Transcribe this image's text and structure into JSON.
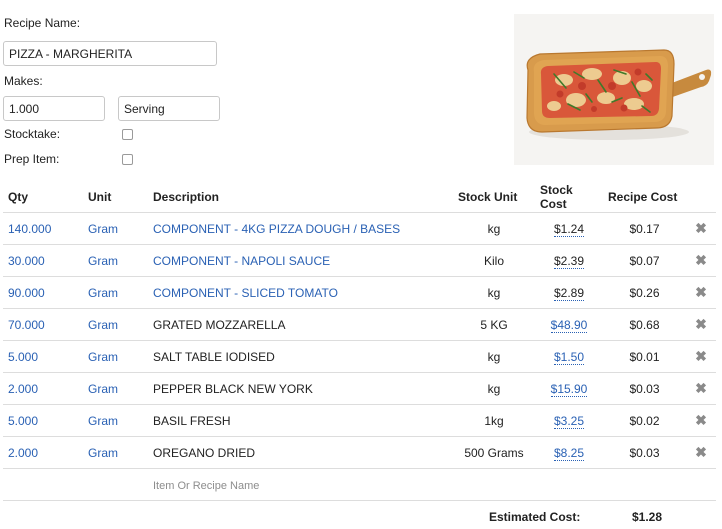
{
  "form": {
    "recipe_name_label": "Recipe Name:",
    "recipe_name_value": "PIZZA - MARGHERITA",
    "makes_label": "Makes:",
    "makes_qty": "1.000",
    "makes_unit": "Serving",
    "stocktake_label": "Stocktake:",
    "stocktake_checked": false,
    "prep_item_label": "Prep Item:",
    "prep_item_checked": false
  },
  "table": {
    "headers": [
      "Qty",
      "Unit",
      "Description",
      "Stock Unit",
      "Stock Cost",
      "Recipe Cost"
    ],
    "rows": [
      {
        "qty": "140.000",
        "unit": "Gram",
        "description": "COMPONENT - 4KG PIZZA DOUGH / BASES",
        "desc_link": true,
        "stock_unit": "kg",
        "stock_cost": "$1.24",
        "cost_link": false,
        "recipe_cost": "$0.17"
      },
      {
        "qty": "30.000",
        "unit": "Gram",
        "description": "COMPONENT - NAPOLI SAUCE",
        "desc_link": true,
        "stock_unit": "Kilo",
        "stock_cost": "$2.39",
        "cost_link": false,
        "recipe_cost": "$0.07"
      },
      {
        "qty": "90.000",
        "unit": "Gram",
        "description": "COMPONENT - SLICED TOMATO",
        "desc_link": true,
        "stock_unit": "kg",
        "stock_cost": "$2.89",
        "cost_link": false,
        "recipe_cost": "$0.26"
      },
      {
        "qty": "70.000",
        "unit": "Gram",
        "description": "GRATED MOZZARELLA",
        "desc_link": false,
        "stock_unit": "5 KG",
        "stock_cost": "$48.90",
        "cost_link": true,
        "recipe_cost": "$0.68"
      },
      {
        "qty": "5.000",
        "unit": "Gram",
        "description": "SALT TABLE IODISED",
        "desc_link": false,
        "stock_unit": "kg",
        "stock_cost": "$1.50",
        "cost_link": true,
        "recipe_cost": "$0.01"
      },
      {
        "qty": "2.000",
        "unit": "Gram",
        "description": "PEPPER BLACK NEW YORK",
        "desc_link": false,
        "stock_unit": "kg",
        "stock_cost": "$15.90",
        "cost_link": true,
        "recipe_cost": "$0.03"
      },
      {
        "qty": "5.000",
        "unit": "Gram",
        "description": "BASIL FRESH",
        "desc_link": false,
        "stock_unit": "1kg",
        "stock_cost": "$3.25",
        "cost_link": true,
        "recipe_cost": "$0.02"
      },
      {
        "qty": "2.000",
        "unit": "Gram",
        "description": "OREGANO DRIED",
        "desc_link": false,
        "stock_unit": "500 Grams",
        "stock_cost": "$8.25",
        "cost_link": true,
        "recipe_cost": "$0.03"
      }
    ],
    "add_placeholder": "Item Or Recipe Name"
  },
  "summary": {
    "estimated_cost_label": "Estimated Cost:",
    "estimated_cost_value": "$1.28"
  },
  "icons": {
    "delete": "close-icon",
    "photo": "pizza-photo"
  },
  "colors": {
    "link": "#2a61b4",
    "delete_icon": "#8a8a8a"
  }
}
